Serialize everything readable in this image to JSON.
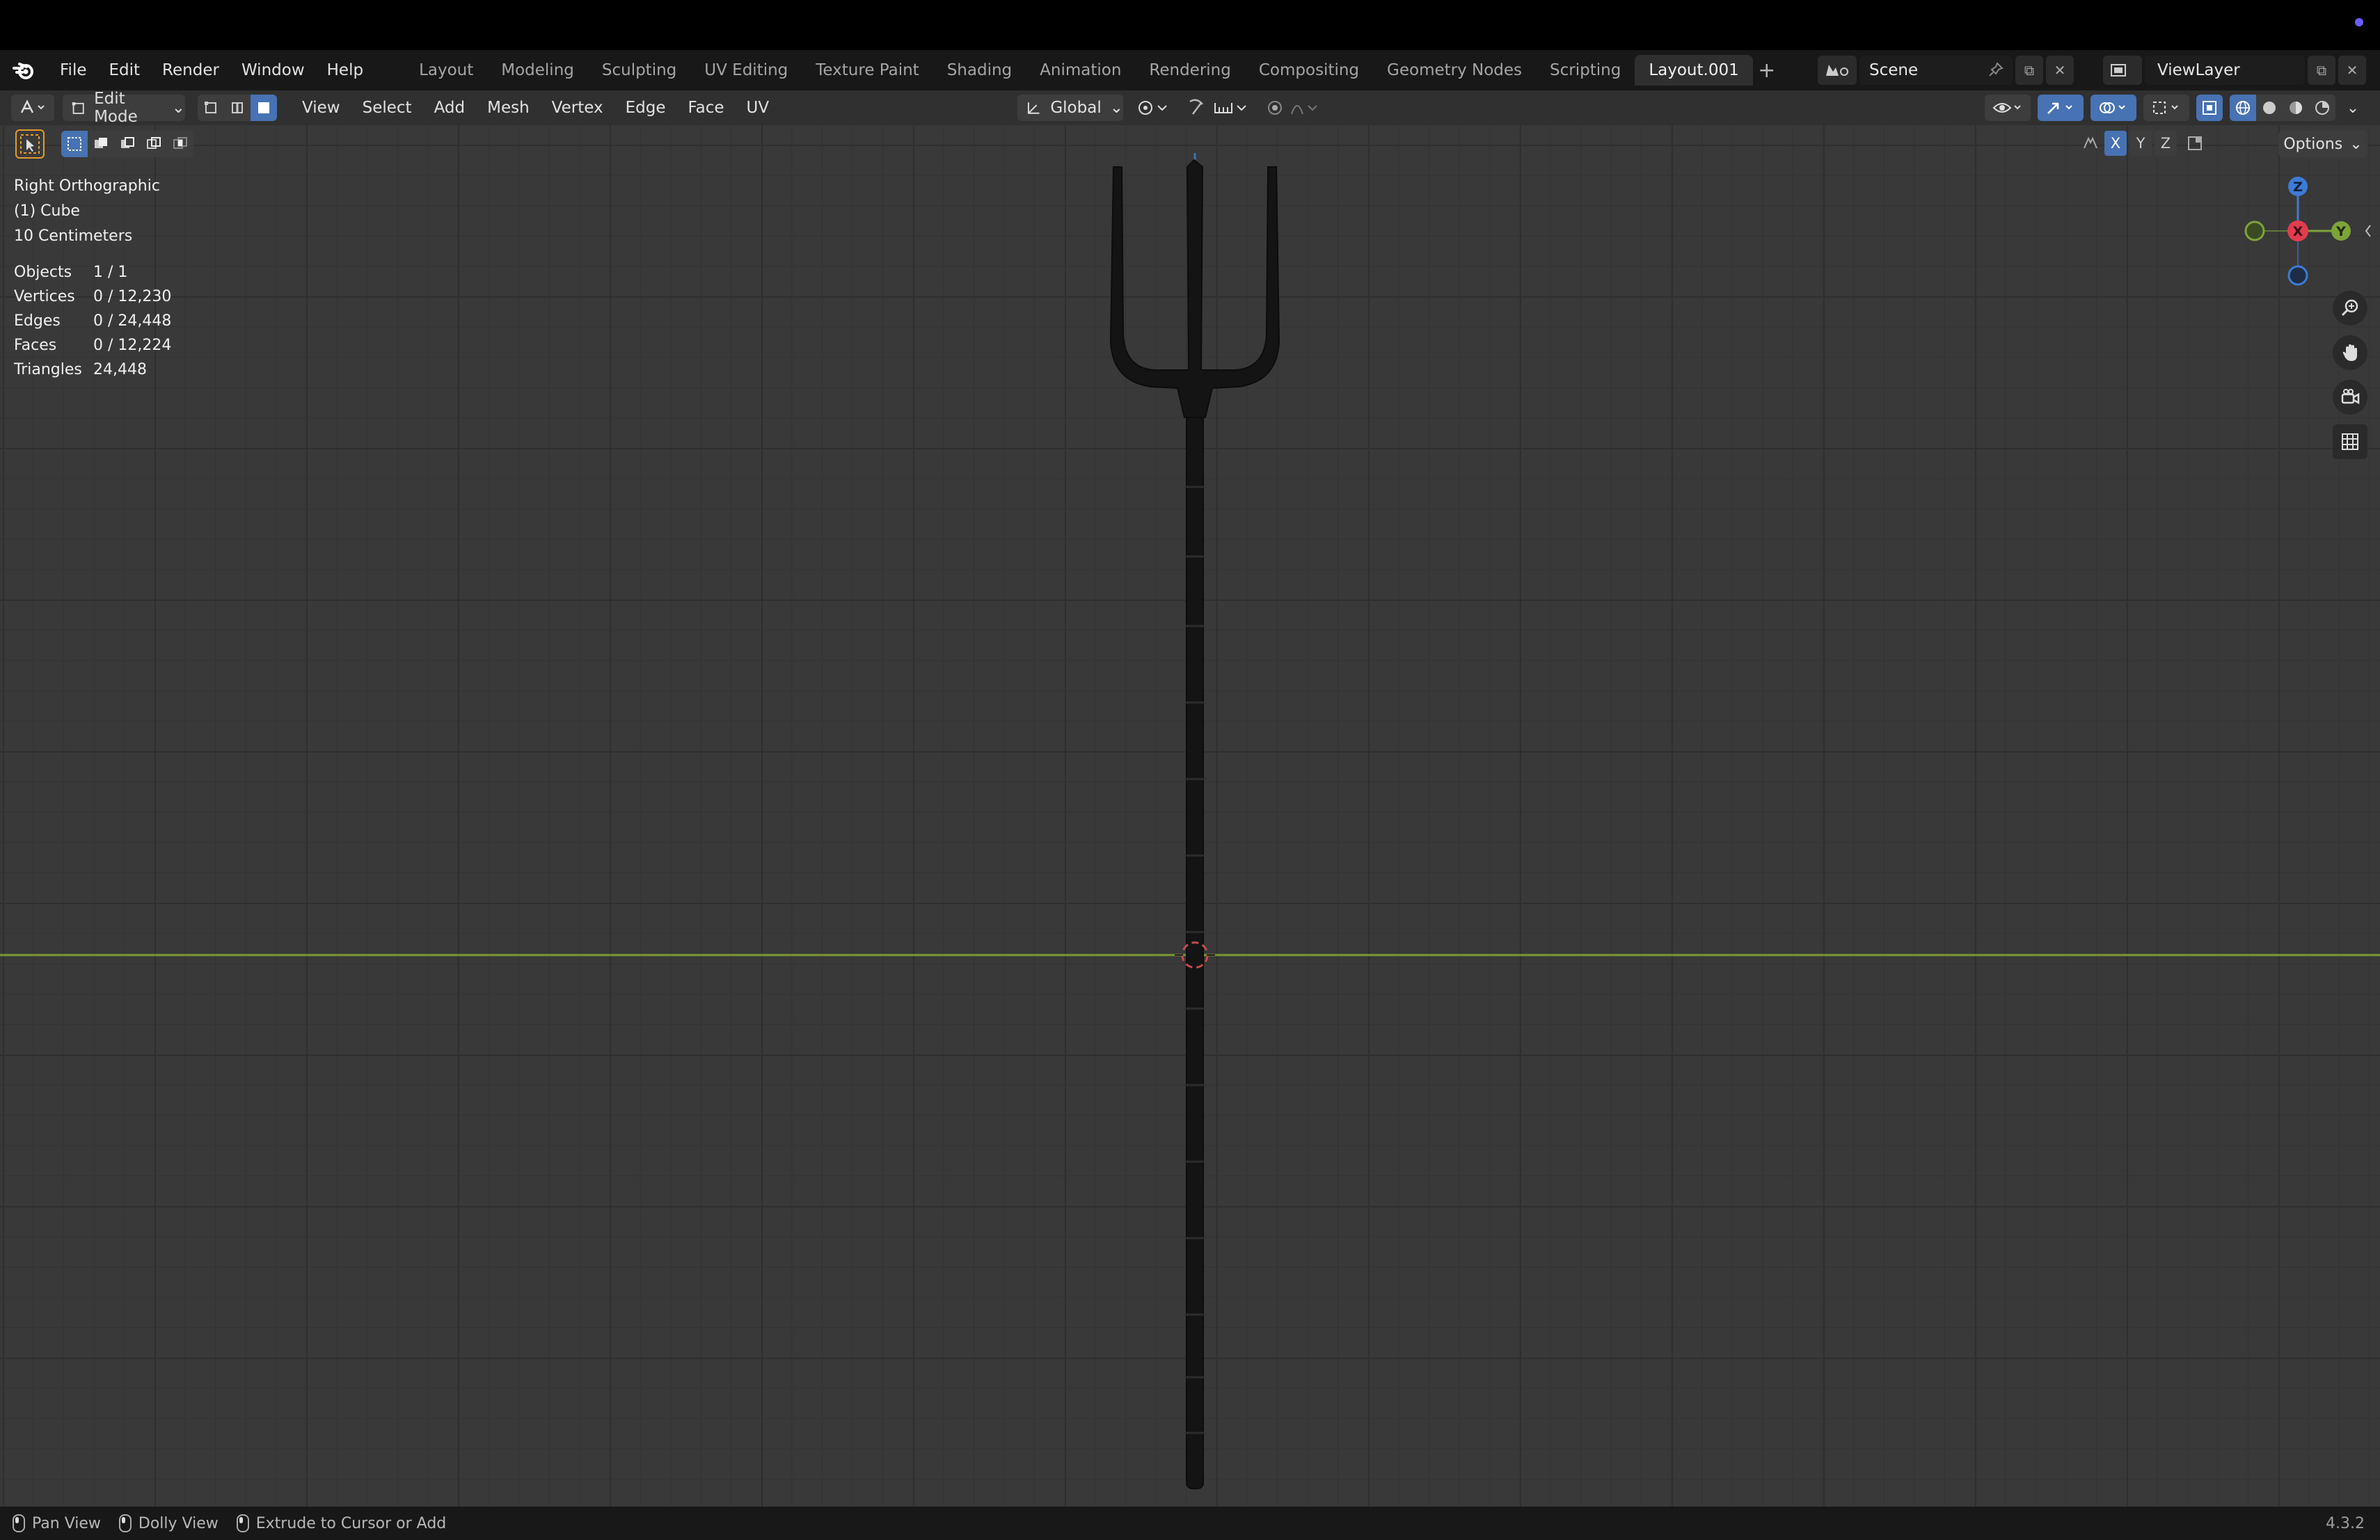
{
  "topbar": {
    "menu": [
      "File",
      "Edit",
      "Render",
      "Window",
      "Help"
    ],
    "workspaces": [
      "Layout",
      "Modeling",
      "Sculpting",
      "UV Editing",
      "Texture Paint",
      "Shading",
      "Animation",
      "Rendering",
      "Compositing",
      "Geometry Nodes",
      "Scripting",
      "Layout.001"
    ],
    "active_workspace": "Layout.001",
    "scene": "Scene",
    "view_layer": "ViewLayer"
  },
  "header": {
    "mode": "Edit Mode",
    "menu": [
      "View",
      "Select",
      "Add",
      "Mesh",
      "Vertex",
      "Edge",
      "Face",
      "UV"
    ],
    "orientation": "Global",
    "options": "Options",
    "axes": [
      "X",
      "Y",
      "Z"
    ]
  },
  "viewport": {
    "view_name": "Right Orthographic",
    "object": "(1) Cube",
    "scale": "10 Centimeters",
    "stats": [
      {
        "label": "Objects",
        "value": "1 / 1"
      },
      {
        "label": "Vertices",
        "value": "0 / 12,230"
      },
      {
        "label": "Edges",
        "value": "0 / 24,448"
      },
      {
        "label": "Faces",
        "value": "0 / 12,224"
      },
      {
        "label": "Triangles",
        "value": "24,448"
      }
    ],
    "gizmo_axes": [
      "Z",
      "X",
      "Y"
    ]
  },
  "statusbar": {
    "items": [
      "Pan View",
      "Dolly View",
      "Extrude to Cursor or Add"
    ],
    "version": "4.3.2"
  },
  "colors": {
    "accent": "#4772b3",
    "x_axis": "#e23c4f",
    "y_axis": "#7ea33a",
    "z_axis": "#3d7bd5"
  }
}
